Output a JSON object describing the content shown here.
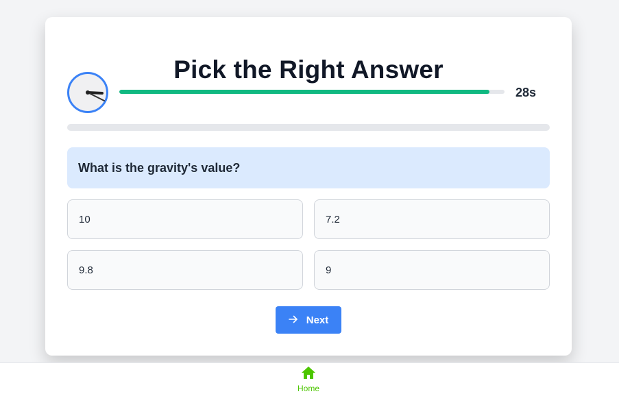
{
  "quiz": {
    "title": "Pick the Right Answer",
    "timer_text": "28s",
    "timer_fraction": 0.96,
    "progress_fraction": 0,
    "question": "What is the gravity's value?",
    "options": [
      "10",
      "7.2",
      "9.8",
      "9"
    ],
    "next_label": "Next"
  },
  "nav": {
    "home_label": "Home"
  },
  "icons": {
    "timer": "clock-icon",
    "next": "arrow-right-icon",
    "home": "home-icon"
  },
  "colors": {
    "accent": "#3b82f6",
    "timer_bar": "#10b981",
    "question_bg": "#dbeafe",
    "home_icon": "#4cc600"
  }
}
